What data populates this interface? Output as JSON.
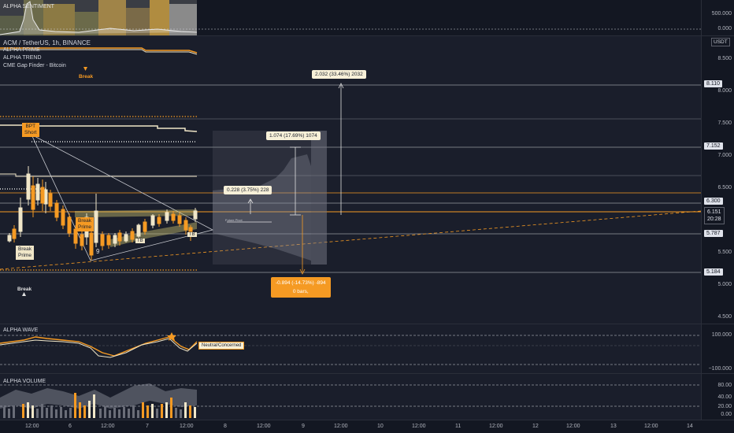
{
  "sentiment_pane": {
    "title": "ALPHA SENTIMENT",
    "ticks": [
      "500.000",
      "0.000"
    ]
  },
  "main_pane": {
    "symbol": "ACM / TetherUS, 1h, BINANCE",
    "indicators": [
      "ALPHA PRIME",
      "ALPHA TREND",
      "CME Gap Finder - Bitcoin"
    ],
    "currency": "USDT",
    "ticks": [
      "8.500",
      "8.000",
      "7.500",
      "7.000",
      "6.500",
      "5.500",
      "5.000",
      "4.500"
    ],
    "price_labels": {
      "high": "8.110",
      "upper": "7.152",
      "resistance": "6.300",
      "current": "6.151",
      "countdown": "20:28",
      "support": "5.787",
      "low": "5.184"
    },
    "annotations": {
      "break_top": "Break",
      "bpt_short_1": "BPT",
      "bpt_short_2": "Short",
      "break_prime_left_1": "Break",
      "break_prime_left_2": "Prime",
      "break_prime_mid_1": "Break",
      "break_prime_mid_2": "Prime",
      "tb_1": "TB",
      "tb_2": "TB",
      "num_9": "9",
      "break_bottom": "Break",
      "future_pivot": "Future Pivot"
    },
    "measures": {
      "m1": "2.032 (33.46%) 2032",
      "m2": "1.074 (17.69%) 1074",
      "m3": "0.228 (3.75%) 228",
      "m4_line1": "-0.894 (-14.73%) -894",
      "m4_line2": "0 bars,"
    }
  },
  "wave_pane": {
    "title": "ALPHA WAVE",
    "ticks": [
      "100.000",
      "−100.000"
    ],
    "label": "Neutral/Concerned"
  },
  "volume_pane": {
    "title": "ALPHA VOLUME",
    "ticks": [
      "80.00",
      "40.00",
      "20.00",
      "0.00"
    ]
  },
  "time_axis": [
    "12:00",
    "6",
    "12:00",
    "7",
    "12:00",
    "8",
    "12:00",
    "9",
    "12:00",
    "10",
    "12:00",
    "11",
    "12:00",
    "12",
    "12:00",
    "13",
    "12:00",
    "14"
  ],
  "colors": {
    "accent": "#f59a23",
    "background": "#131722",
    "pane": "#1a1e2b",
    "bull": "#f0e6c8",
    "bear": "#f59a23"
  }
}
